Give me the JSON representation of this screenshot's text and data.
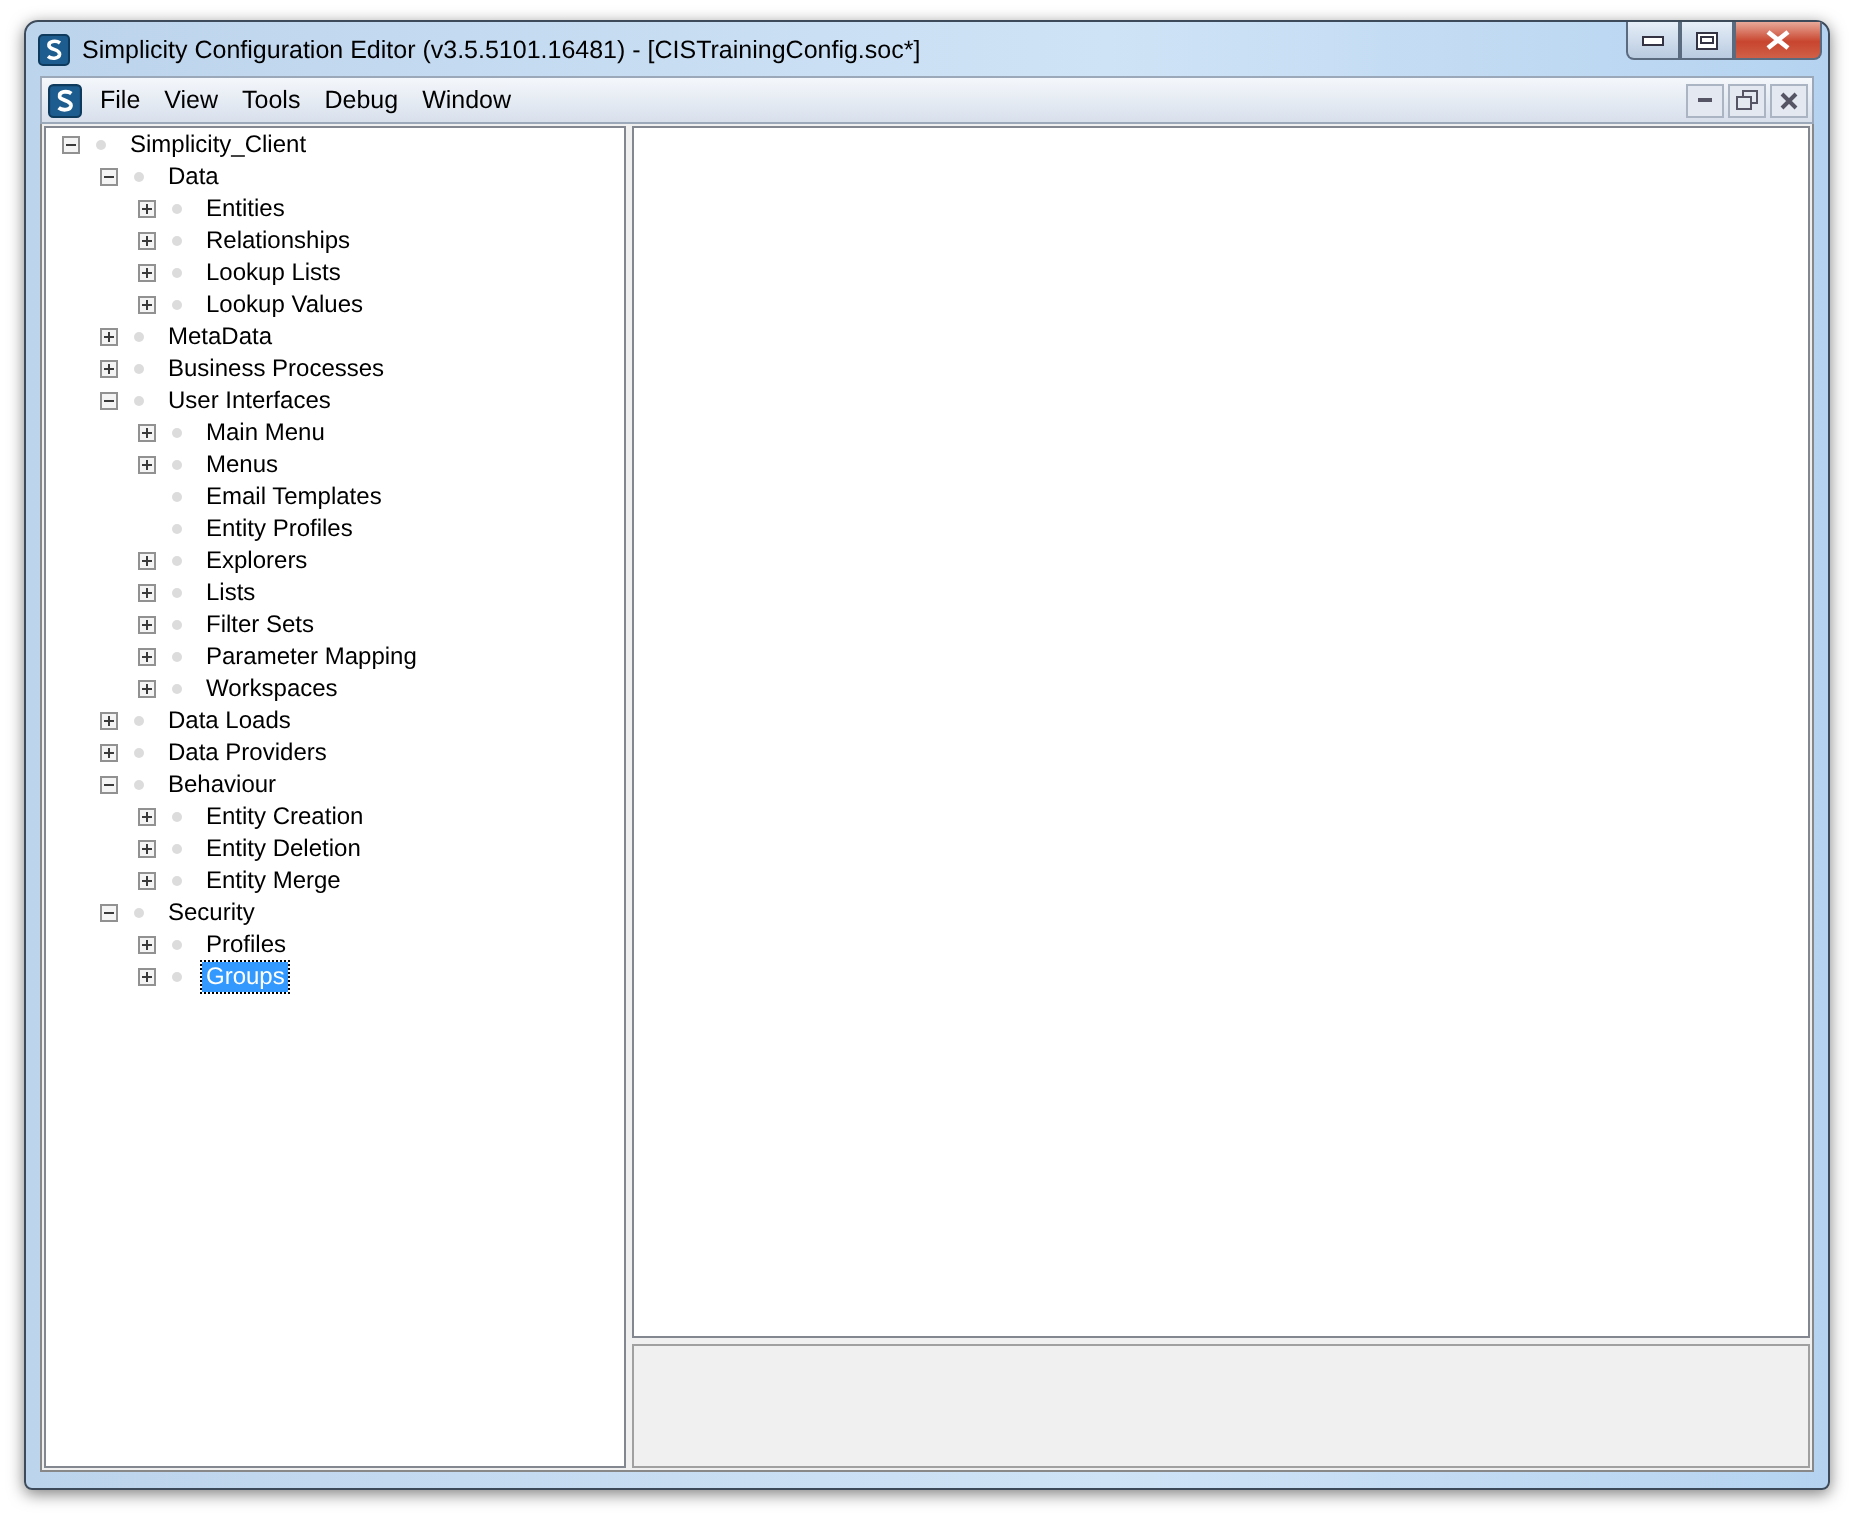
{
  "window": {
    "title": "Simplicity Configuration Editor (v3.5.5101.16481) - [CISTrainingConfig.soc*]"
  },
  "menu": [
    "File",
    "View",
    "Tools",
    "Debug",
    "Window"
  ],
  "tree": [
    {
      "label": "Simplicity_Client",
      "kind": "expandable",
      "expanded": true,
      "selected": false,
      "children": [
        {
          "label": "Data",
          "kind": "expandable",
          "expanded": true,
          "selected": false,
          "children": [
            {
              "label": "Entities",
              "kind": "expandable",
              "expanded": false,
              "selected": false
            },
            {
              "label": "Relationships",
              "kind": "expandable",
              "expanded": false,
              "selected": false
            },
            {
              "label": "Lookup Lists",
              "kind": "expandable",
              "expanded": false,
              "selected": false
            },
            {
              "label": "Lookup Values",
              "kind": "expandable",
              "expanded": false,
              "selected": false
            }
          ]
        },
        {
          "label": "MetaData",
          "kind": "expandable",
          "expanded": false,
          "selected": false
        },
        {
          "label": "Business Processes",
          "kind": "expandable",
          "expanded": false,
          "selected": false
        },
        {
          "label": "User Interfaces",
          "kind": "expandable",
          "expanded": true,
          "selected": false,
          "children": [
            {
              "label": "Main Menu",
              "kind": "expandable",
              "expanded": false,
              "selected": false
            },
            {
              "label": "Menus",
              "kind": "expandable",
              "expanded": false,
              "selected": false
            },
            {
              "label": "Email Templates",
              "kind": "leaf",
              "selected": false
            },
            {
              "label": "Entity Profiles",
              "kind": "leaf",
              "selected": false
            },
            {
              "label": "Explorers",
              "kind": "expandable",
              "expanded": false,
              "selected": false
            },
            {
              "label": "Lists",
              "kind": "expandable",
              "expanded": false,
              "selected": false
            },
            {
              "label": "Filter Sets",
              "kind": "expandable",
              "expanded": false,
              "selected": false
            },
            {
              "label": "Parameter Mapping",
              "kind": "expandable",
              "expanded": false,
              "selected": false
            },
            {
              "label": "Workspaces",
              "kind": "expandable",
              "expanded": false,
              "selected": false
            }
          ]
        },
        {
          "label": "Data Loads",
          "kind": "expandable",
          "expanded": false,
          "selected": false
        },
        {
          "label": "Data Providers",
          "kind": "expandable",
          "expanded": false,
          "selected": false
        },
        {
          "label": "Behaviour",
          "kind": "expandable",
          "expanded": true,
          "selected": false,
          "children": [
            {
              "label": "Entity Creation",
              "kind": "expandable",
              "expanded": false,
              "selected": false
            },
            {
              "label": "Entity Deletion",
              "kind": "expandable",
              "expanded": false,
              "selected": false
            },
            {
              "label": "Entity Merge",
              "kind": "expandable",
              "expanded": false,
              "selected": false
            }
          ]
        },
        {
          "label": "Security",
          "kind": "expandable",
          "expanded": true,
          "selected": false,
          "children": [
            {
              "label": "Profiles",
              "kind": "expandable",
              "expanded": false,
              "selected": false
            },
            {
              "label": "Groups",
              "kind": "expandable",
              "expanded": false,
              "selected": true
            }
          ]
        }
      ]
    }
  ]
}
